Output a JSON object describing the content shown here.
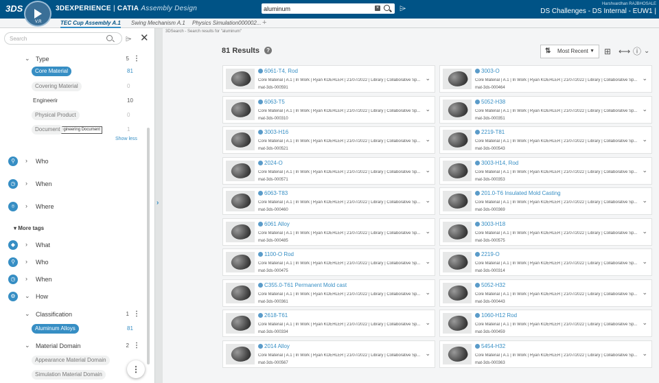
{
  "app": {
    "logo": "3DS",
    "compass_v": "V.R",
    "brand_name": "3DEXPERIENCE",
    "brand_sep": " | ",
    "product": "CATIA",
    "app_name": "Assembly Design",
    "search_value": "aluminum",
    "user": "Harshvardhan RAJBHOSALE",
    "tenant": "DS Challenges - DS Internal - EUW1 |"
  },
  "tabs": [
    {
      "label": "TEC Cup Assembly A.1",
      "active": true
    },
    {
      "label": "Swing Mechanism A.1",
      "active": false
    },
    {
      "label": "Physics Simulation000002...",
      "active": false
    }
  ],
  "left": {
    "search_placeholder": "Search",
    "type": {
      "label": "Type",
      "count": "5"
    },
    "type_facets": [
      {
        "label": "Core Material",
        "count": "81",
        "selected": true
      },
      {
        "label": "Covering Material",
        "count": "0",
        "selected": false
      },
      {
        "label": "Engineering Document",
        "count": "10",
        "selected": false
      },
      {
        "label": "Physical Product",
        "count": "0",
        "selected": false
      },
      {
        "label": "Document",
        "count": "1",
        "selected": false
      }
    ],
    "tooltip": "Engineering Document",
    "show_less": "Show less",
    "groups": [
      {
        "label": "Who"
      },
      {
        "label": "When"
      },
      {
        "label": "Where"
      }
    ],
    "more_tags": "More tags",
    "more_groups": [
      {
        "label": "What"
      },
      {
        "label": "Who"
      },
      {
        "label": "When"
      },
      {
        "label": "How"
      }
    ],
    "classification": {
      "label": "Classification",
      "count": "1",
      "facet": "Aluminum Alloys",
      "facet_count": "81"
    },
    "material_domain": {
      "label": "Material Domain",
      "count": "2",
      "facets": [
        "Appearance Material Domain",
        "Simulation Material Domain"
      ]
    }
  },
  "main": {
    "breadcrumb": "3DSearch - Search results for \"aluminum\"",
    "results_count": "81",
    "results_label": "Results",
    "sort_label": "Most Recent",
    "cards": [
      {
        "title": "6061-T4, Rod",
        "desc": "Core Material | A.1 | In Work | Ryan KOEHLER | 21/07/2022 | Library | Collaborative Sp...",
        "id": "mat-3ds-000591"
      },
      {
        "title": "3003-O",
        "desc": "Core Material | A.1 | In Work | Ryan KOEHLER | 21/07/2022 | Library | Collaborative Sp...",
        "id": "mat-3ds-000464"
      },
      {
        "title": "6063-T5",
        "desc": "Core Material | A.1 | In Work | Ryan KOEHLER | 21/07/2022 | Library | Collaborative Sp...",
        "id": "mat-3ds-000310"
      },
      {
        "title": "5052-H38",
        "desc": "Core Material | A.1 | In Work | Ryan KOEHLER | 21/07/2022 | Library | Collaborative Sp...",
        "id": "mat-3ds-000351"
      },
      {
        "title": "3003-H16",
        "desc": "Core Material | A.1 | In Work | Ryan KOEHLER | 21/07/2022 | Library | Collaborative Sp...",
        "id": "mat-3ds-000521"
      },
      {
        "title": "2219-T81",
        "desc": "Core Material | A.1 | In Work | Ryan KOEHLER | 21/07/2022 | Library | Collaborative Sp...",
        "id": "mat-3ds-000543"
      },
      {
        "title": "2024-O",
        "desc": "Core Material | A.1 | In Work | Ryan KOEHLER | 21/07/2022 | Library | Collaborative Sp...",
        "id": "mat-3ds-000571"
      },
      {
        "title": "3003-H14, Rod",
        "desc": "Core Material | A.1 | In Work | Ryan KOEHLER | 21/07/2022 | Library | Collaborative Sp...",
        "id": "mat-3ds-000353"
      },
      {
        "title": "6063-T83",
        "desc": "Core Material | A.1 | In Work | Ryan KOEHLER | 21/07/2022 | Library | Collaborative Sp...",
        "id": "mat-3ds-000460"
      },
      {
        "title": "201.0-T6 Insulated Mold Casting",
        "desc": "Core Material | A.1 | In Work | Ryan KOEHLER | 21/07/2022 | Library | Collaborative Sp...",
        "id": "mat-3ds-000369"
      },
      {
        "title": "6061 Alloy",
        "desc": "Core Material | A.1 | In Work | Ryan KOEHLER | 21/07/2022 | Library | Collaborative Sp...",
        "id": "mat-3ds-000485"
      },
      {
        "title": "3003-H18",
        "desc": "Core Material | A.1 | In Work | Ryan KOEHLER | 21/07/2022 | Library | Collaborative Sp...",
        "id": "mat-3ds-000575"
      },
      {
        "title": "1100-O Rod",
        "desc": "Core Material | A.1 | In Work | Ryan KOEHLER | 21/07/2022 | Library | Collaborative Sp...",
        "id": "mat-3ds-000475"
      },
      {
        "title": "2219-O",
        "desc": "Core Material | A.1 | In Work | Ryan KOEHLER | 21/07/2022 | Library | Collaborative Sp...",
        "id": "mat-3ds-000314"
      },
      {
        "title": "C355.0-T61 Permanent Mold cast",
        "desc": "Core Material | A.1 | In Work | Ryan KOEHLER | 21/07/2022 | Library | Collaborative Sp...",
        "id": "mat-3ds-000361"
      },
      {
        "title": "5052-H32",
        "desc": "Core Material | A.1 | In Work | Ryan KOEHLER | 21/07/2022 | Library | Collaborative Sp...",
        "id": "mat-3ds-000443"
      },
      {
        "title": "2618-T61",
        "desc": "Core Material | A.1 | In Work | Ryan KOEHLER | 21/07/2022 | Library | Collaborative Sp...",
        "id": "mat-3ds-000334"
      },
      {
        "title": "1060-H12 Rod",
        "desc": "Core Material | A.1 | In Work | Ryan KOEHLER | 21/07/2022 | Library | Collaborative Sp...",
        "id": "mat-3ds-000459"
      },
      {
        "title": "2014 Alloy",
        "desc": "Core Material | A.1 | In Work | Ryan KOEHLER | 21/07/2022 | Library | Collaborative Sp...",
        "id": "mat-3ds-000567"
      },
      {
        "title": "5454-H32",
        "desc": "Core Material | A.1 | In Work | Ryan KOEHLER | 21/07/2022 | Library | Collaborative Sp...",
        "id": "mat-3ds-000363"
      }
    ]
  },
  "colors": {
    "topbar": "#005386",
    "accent": "#368ec4"
  },
  "icons": [
    "ds-logo-icon",
    "compass-icon",
    "search-icon",
    "clear-icon",
    "tag-icon",
    "close-icon",
    "chevron-down-icon",
    "chevron-right-icon",
    "kebab-icon",
    "who-icon",
    "when-icon",
    "where-icon",
    "what-icon",
    "how-icon",
    "help-icon",
    "sort-icon",
    "grid-view-icon",
    "list-view-icon",
    "info-icon",
    "material-icon"
  ]
}
